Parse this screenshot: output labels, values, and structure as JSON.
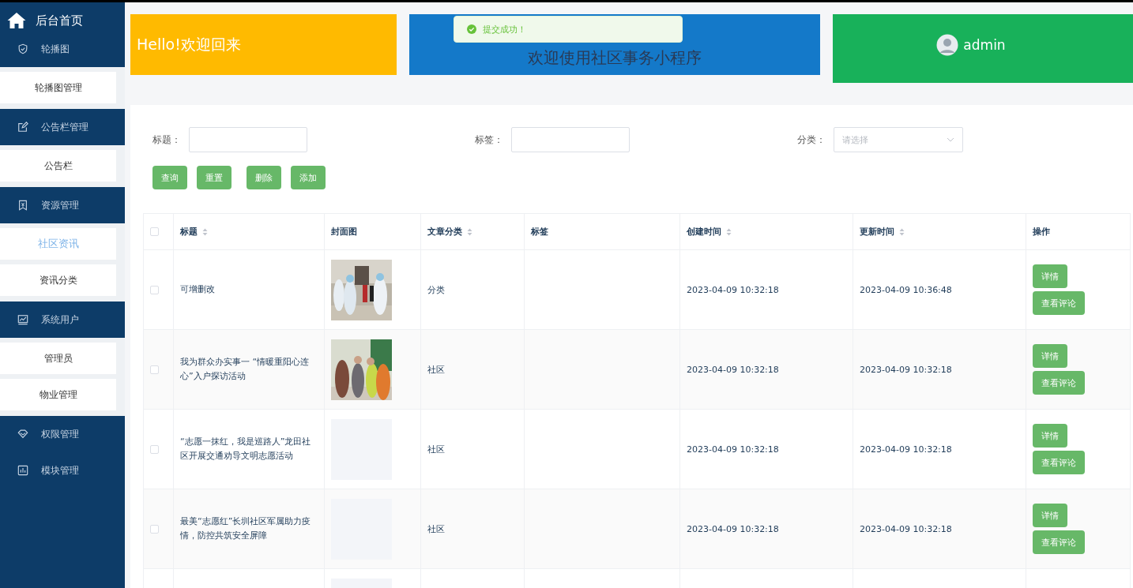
{
  "sidebar": {
    "title": "后台首页",
    "groups": [
      {
        "label": "轮播图",
        "children": [
          {
            "label": "轮播图管理",
            "selected": false
          }
        ]
      },
      {
        "label": "公告栏管理",
        "children": [
          {
            "label": "公告栏",
            "selected": false
          }
        ]
      },
      {
        "label": "资源管理",
        "children": [
          {
            "label": "社区资讯",
            "selected": true
          },
          {
            "label": "资讯分类",
            "selected": false
          }
        ]
      },
      {
        "label": "系统用户",
        "children": [
          {
            "label": "管理员",
            "selected": false
          },
          {
            "label": "物业管理",
            "selected": false
          }
        ]
      },
      {
        "label": "权限管理"
      },
      {
        "label": "模块管理"
      }
    ]
  },
  "banners": [
    {
      "kind": "welcome",
      "text": "Hello!欢迎回来"
    },
    {
      "kind": "intro",
      "text": "欢迎使用社区事务小程序"
    },
    {
      "kind": "user",
      "text": "admin"
    }
  ],
  "toast": {
    "kind": "success",
    "text": "提交成功！"
  },
  "filters": [
    {
      "kind": "input",
      "label": "标题："
    },
    {
      "kind": "input",
      "label": "标签："
    },
    {
      "kind": "select",
      "label": "分类：",
      "placeholder": "请选择"
    }
  ],
  "actions": [
    "查询",
    "重置",
    "删除",
    "添加"
  ],
  "table": {
    "select_all": {
      "checked": false
    },
    "columns": [
      {
        "label": "标题",
        "sortable": true
      },
      {
        "label": "封面图",
        "sortable": false
      },
      {
        "label": "文章分类",
        "sortable": true
      },
      {
        "label": "标签",
        "sortable": false
      },
      {
        "label": "创建时间",
        "sortable": true
      },
      {
        "label": "更新时间",
        "sortable": true
      },
      {
        "label": "操作",
        "sortable": false
      }
    ],
    "rows": [
      {
        "checked": false,
        "title": "可增删改",
        "cover": {
          "kind": "picture"
        },
        "category": "分类",
        "created": "2023-04-09 10:32:18",
        "updated": "2023-04-09 10:36:48",
        "buttons": [
          "详情",
          "查看评论"
        ]
      },
      {
        "checked": false,
        "title": "我为群众办实事一 “情暖重阳心连心”入户探访活动",
        "cover": {
          "kind": "picture"
        },
        "category": "社区",
        "created": "2023-04-09 10:32:18",
        "updated": "2023-04-09 10:32:18",
        "buttons": [
          "详情",
          "查看评论"
        ]
      },
      {
        "checked": false,
        "title": "“志愿一抹红，我是巡路人”龙田社区开展交通劝导文明志愿活动",
        "cover": {
          "kind": "empty"
        },
        "category": "社区",
        "created": "2023-04-09 10:32:18",
        "updated": "2023-04-09 10:32:18",
        "buttons": [
          "详情",
          "查看评论"
        ]
      },
      {
        "checked": false,
        "title": "最美“志愿红”长圳社区军属助力疫情，防控共筑安全屏障",
        "cover": {
          "kind": "empty"
        },
        "category": "社区",
        "created": "2023-04-09 10:32:18",
        "updated": "2023-04-09 10:32:18",
        "buttons": [
          "详情",
          "查看评论"
        ]
      },
      {
        "cover": {
          "kind": "empty"
        }
      }
    ]
  }
}
